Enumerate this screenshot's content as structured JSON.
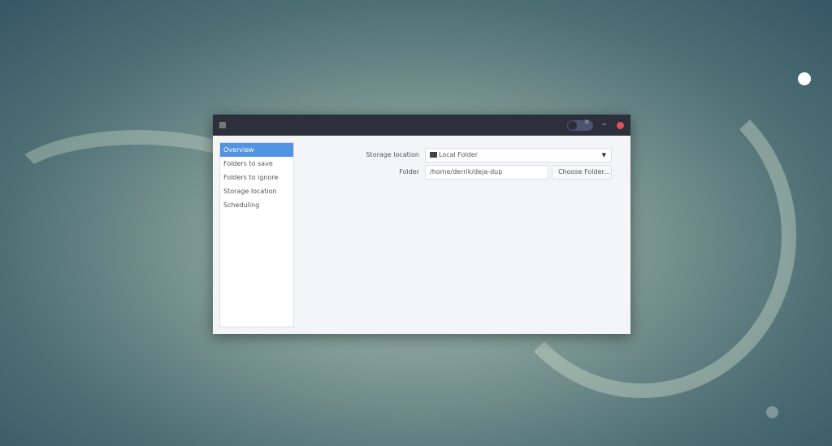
{
  "window": {
    "toggle_icon": "close-icon",
    "minimize": "–"
  },
  "sidebar": {
    "items": [
      {
        "label": "Overview"
      },
      {
        "label": "Folders to save"
      },
      {
        "label": "Folders to ignore"
      },
      {
        "label": "Storage location"
      },
      {
        "label": "Scheduling"
      }
    ]
  },
  "main": {
    "storage_label": "Storage location",
    "storage_value": "Local Folder",
    "folder_label": "Folder",
    "folder_value": "/home/derrik/deja-dup",
    "choose_button": "Choose Folder..."
  },
  "colors": {
    "accent": "#5294e2",
    "titlebar": "#2c303a",
    "close": "#e0505a"
  }
}
